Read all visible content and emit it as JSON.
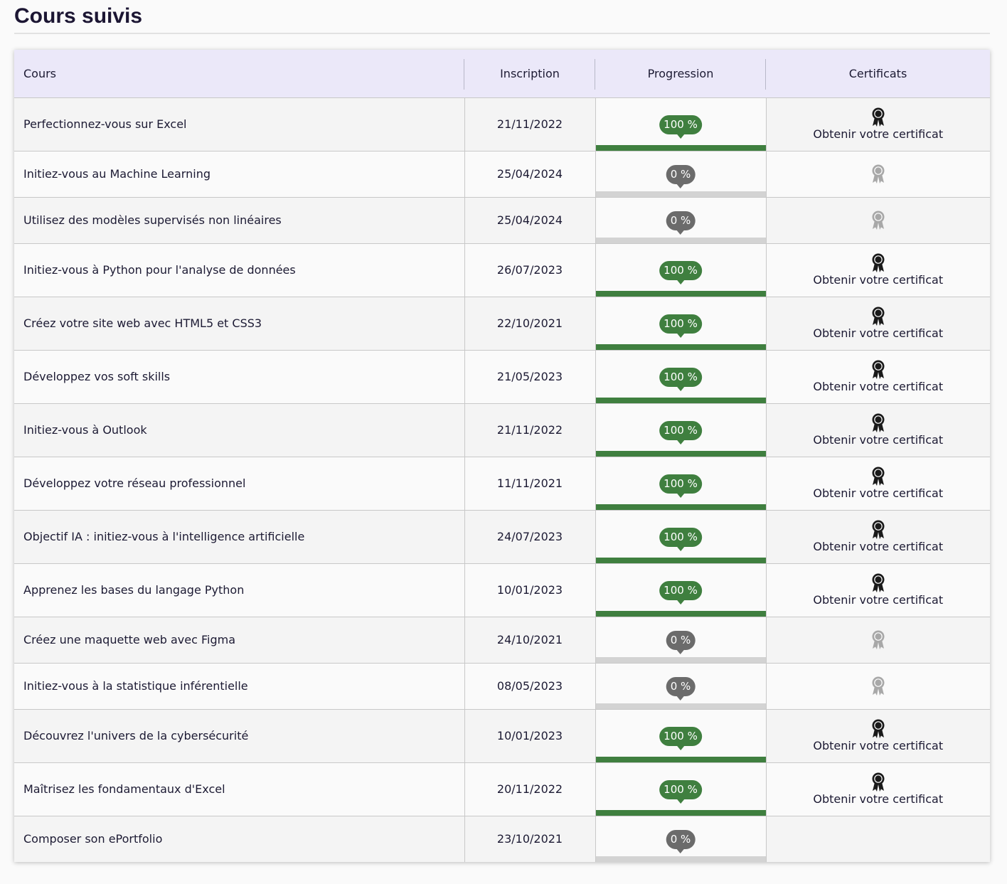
{
  "page": {
    "title": "Cours suivis"
  },
  "table": {
    "headers": {
      "course": "Cours",
      "inscription": "Inscription",
      "progression": "Progression",
      "certificates": "Certificats"
    },
    "rows": [
      {
        "course": "Perfectionnez-vous sur Excel",
        "date": "21/11/2022",
        "progress_label": "100 %",
        "progress": 100,
        "certificate": "available",
        "certificate_label": "Obtenir votre certificat"
      },
      {
        "course": "Initiez-vous au Machine Learning",
        "date": "25/04/2024",
        "progress_label": "0 %",
        "progress": 0,
        "certificate": "locked",
        "certificate_label": ""
      },
      {
        "course": "Utilisez des modèles supervisés non linéaires",
        "date": "25/04/2024",
        "progress_label": "0 %",
        "progress": 0,
        "certificate": "locked",
        "certificate_label": ""
      },
      {
        "course": "Initiez-vous à Python pour l'analyse de données",
        "date": "26/07/2023",
        "progress_label": "100 %",
        "progress": 100,
        "certificate": "available",
        "certificate_label": "Obtenir votre certificat"
      },
      {
        "course": "Créez votre site web avec HTML5 et CSS3",
        "date": "22/10/2021",
        "progress_label": "100 %",
        "progress": 100,
        "certificate": "available",
        "certificate_label": "Obtenir votre certificat"
      },
      {
        "course": "Développez vos soft skills",
        "date": "21/05/2023",
        "progress_label": "100 %",
        "progress": 100,
        "certificate": "available",
        "certificate_label": "Obtenir votre certificat"
      },
      {
        "course": "Initiez-vous à Outlook",
        "date": "21/11/2022",
        "progress_label": "100 %",
        "progress": 100,
        "certificate": "available",
        "certificate_label": "Obtenir votre certificat"
      },
      {
        "course": "Développez votre réseau professionnel",
        "date": "11/11/2021",
        "progress_label": "100 %",
        "progress": 100,
        "certificate": "available",
        "certificate_label": "Obtenir votre certificat"
      },
      {
        "course": "Objectif IA : initiez-vous à l'intelligence artificielle",
        "date": "24/07/2023",
        "progress_label": "100 %",
        "progress": 100,
        "certificate": "available",
        "certificate_label": "Obtenir votre certificat"
      },
      {
        "course": "Apprenez les bases du langage Python",
        "date": "10/01/2023",
        "progress_label": "100 %",
        "progress": 100,
        "certificate": "available",
        "certificate_label": "Obtenir votre certificat"
      },
      {
        "course": "Créez une maquette web avec Figma",
        "date": "24/10/2021",
        "progress_label": "0 %",
        "progress": 0,
        "certificate": "locked",
        "certificate_label": ""
      },
      {
        "course": "Initiez-vous à la statistique inférentielle",
        "date": "08/05/2023",
        "progress_label": "0 %",
        "progress": 0,
        "certificate": "locked",
        "certificate_label": ""
      },
      {
        "course": "Découvrez l'univers de la cybersécurité",
        "date": "10/01/2023",
        "progress_label": "100 %",
        "progress": 100,
        "certificate": "available",
        "certificate_label": "Obtenir votre certificat"
      },
      {
        "course": "Maîtrisez les fondamentaux d'Excel",
        "date": "20/11/2022",
        "progress_label": "100 %",
        "progress": 100,
        "certificate": "available",
        "certificate_label": "Obtenir votre certificat"
      },
      {
        "course": "Composer son ePortfolio",
        "date": "23/10/2021",
        "progress_label": "0 %",
        "progress": 0,
        "certificate": "none",
        "certificate_label": ""
      }
    ]
  },
  "icons": {
    "certificate_available": "award-ribbon-icon",
    "certificate_locked": "award-ribbon-locked-icon"
  },
  "colors": {
    "header_bg": "#ebe8f9",
    "progress_complete": "#3f7f3f",
    "progress_empty_bubble": "#6b6b6b",
    "progress_track": "#d3d3d3",
    "icon_available": "#1a1a1a",
    "icon_locked": "#a8a8a8"
  }
}
